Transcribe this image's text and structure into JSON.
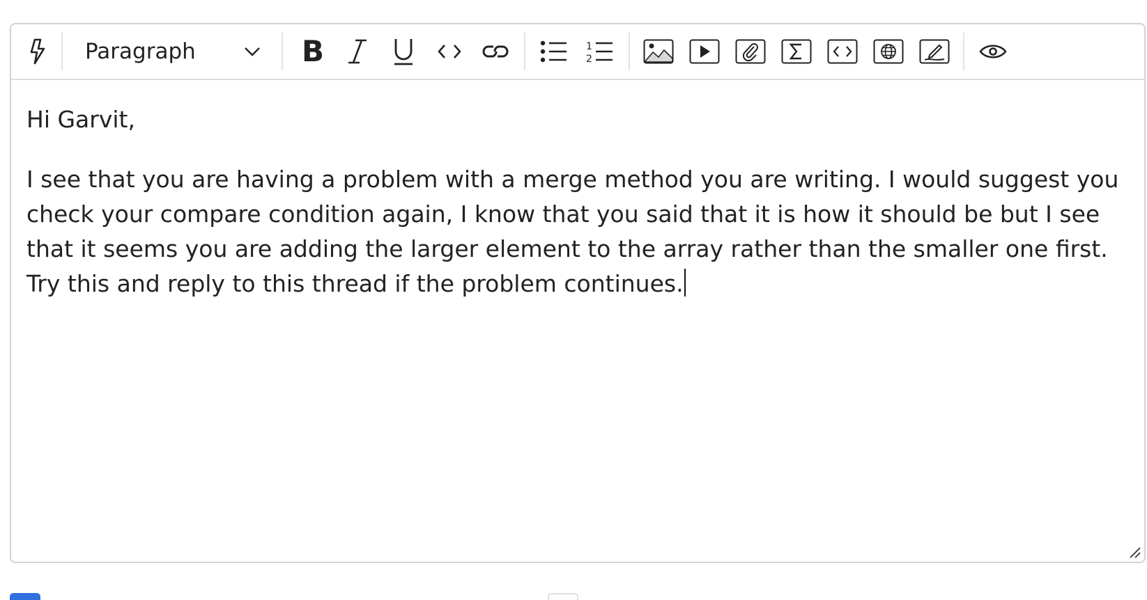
{
  "toolbar": {
    "block_format": "Paragraph",
    "icons": [
      "lightning-icon",
      "bold-icon",
      "italic-icon",
      "underline-icon",
      "inline-code-icon",
      "link-icon",
      "bullet-list-icon",
      "numbered-list-icon",
      "image-icon",
      "video-icon",
      "attachment-icon",
      "math-equation-icon",
      "html-embed-icon",
      "web-embed-icon",
      "signature-icon",
      "preview-icon"
    ]
  },
  "editor": {
    "greeting": "Hi Garvit,",
    "body": "I see that you are having a problem with a merge method you are writing. I would suggest you check your compare condition again, I know that you said that it is how it should be but I see that it seems you are adding the larger element to the array rather than the smaller one first. Try this and reply to this thread if the problem continues."
  },
  "colors": {
    "border": "#d3d3d3",
    "text": "#222222",
    "primary_button": "#2f6fde"
  }
}
